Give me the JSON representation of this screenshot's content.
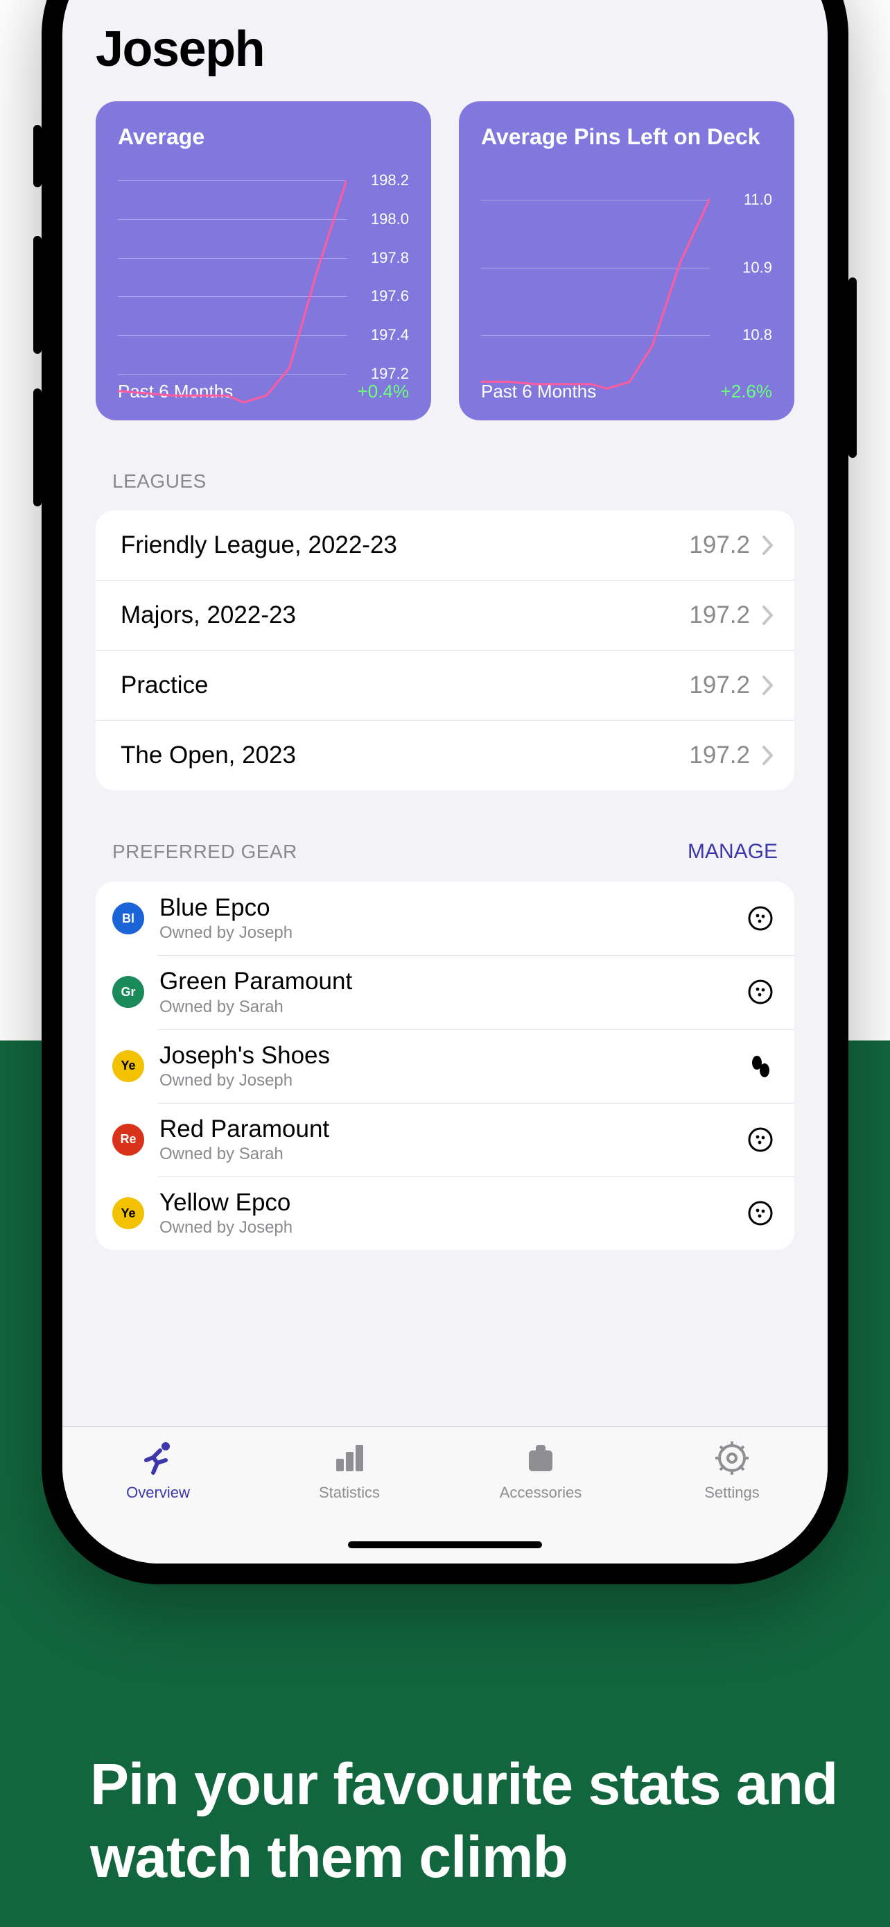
{
  "page": {
    "title": "Joseph"
  },
  "cards": [
    {
      "title": "Average",
      "period": "Past 6 Months",
      "delta": "+0.4%",
      "ticks": [
        "198.2",
        "198.0",
        "197.8",
        "197.6",
        "197.4",
        "197.2"
      ]
    },
    {
      "title": "Average Pins Left on Deck",
      "period": "Past 6 Months",
      "delta": "+2.6%",
      "ticks": [
        "11.0",
        "10.9",
        "10.8"
      ]
    }
  ],
  "leagues": {
    "label": "LEAGUES",
    "items": [
      {
        "name": "Friendly League, 2022-23",
        "score": "197.2"
      },
      {
        "name": "Majors, 2022-23",
        "score": "197.2"
      },
      {
        "name": "Practice",
        "score": "197.2"
      },
      {
        "name": "The Open, 2023",
        "score": "197.2"
      }
    ]
  },
  "gear": {
    "label": "PREFERRED GEAR",
    "manage": "MANAGE",
    "items": [
      {
        "name": "Blue Epco",
        "owner": "Owned by Joseph",
        "badge": "Bl",
        "color": "#1b64d8",
        "icon": "ball"
      },
      {
        "name": "Green Paramount",
        "owner": "Owned by Sarah",
        "badge": "Gr",
        "color": "#1b8a5a",
        "icon": "ball"
      },
      {
        "name": "Joseph's Shoes",
        "owner": "Owned by Joseph",
        "badge": "Ye",
        "color": "#f2c200",
        "icon": "shoes"
      },
      {
        "name": "Red Paramount",
        "owner": "Owned by Sarah",
        "badge": "Re",
        "color": "#d8321b",
        "icon": "ball"
      },
      {
        "name": "Yellow Epco",
        "owner": "Owned by Joseph",
        "badge": "Ye",
        "color": "#f2c200",
        "icon": "ball"
      }
    ]
  },
  "tabs": [
    {
      "label": "Overview",
      "icon": "runner",
      "active": true
    },
    {
      "label": "Statistics",
      "icon": "bars",
      "active": false
    },
    {
      "label": "Accessories",
      "icon": "bag",
      "active": false
    },
    {
      "label": "Settings",
      "icon": "gear",
      "active": false
    }
  ],
  "marketing": {
    "tagline": "Pin your favourite stats and watch them climb"
  },
  "chart_data": [
    {
      "type": "line",
      "title": "Average",
      "ylabel": "",
      "ylim": [
        197.2,
        198.2
      ],
      "yticks": [
        197.2,
        197.4,
        197.6,
        197.8,
        198.0,
        198.2
      ],
      "x": [
        0,
        1,
        2,
        3,
        4,
        5,
        6,
        7,
        8,
        9
      ],
      "y": [
        197.28,
        197.27,
        197.26,
        197.25,
        197.25,
        197.22,
        197.26,
        197.4,
        197.8,
        198.2
      ],
      "period_label": "Past 6 Months",
      "delta": "+0.4%"
    },
    {
      "type": "line",
      "title": "Average Pins Left on Deck",
      "ylabel": "",
      "ylim": [
        10.75,
        11.0
      ],
      "yticks": [
        10.8,
        10.9,
        11.0
      ],
      "x": [
        0,
        1,
        2,
        3,
        4,
        5,
        6,
        7,
        8,
        9
      ],
      "y": [
        10.78,
        10.78,
        10.77,
        10.77,
        10.77,
        10.76,
        10.78,
        10.84,
        10.93,
        11.0
      ],
      "period_label": "Past 6 Months",
      "delta": "+2.6%"
    }
  ]
}
